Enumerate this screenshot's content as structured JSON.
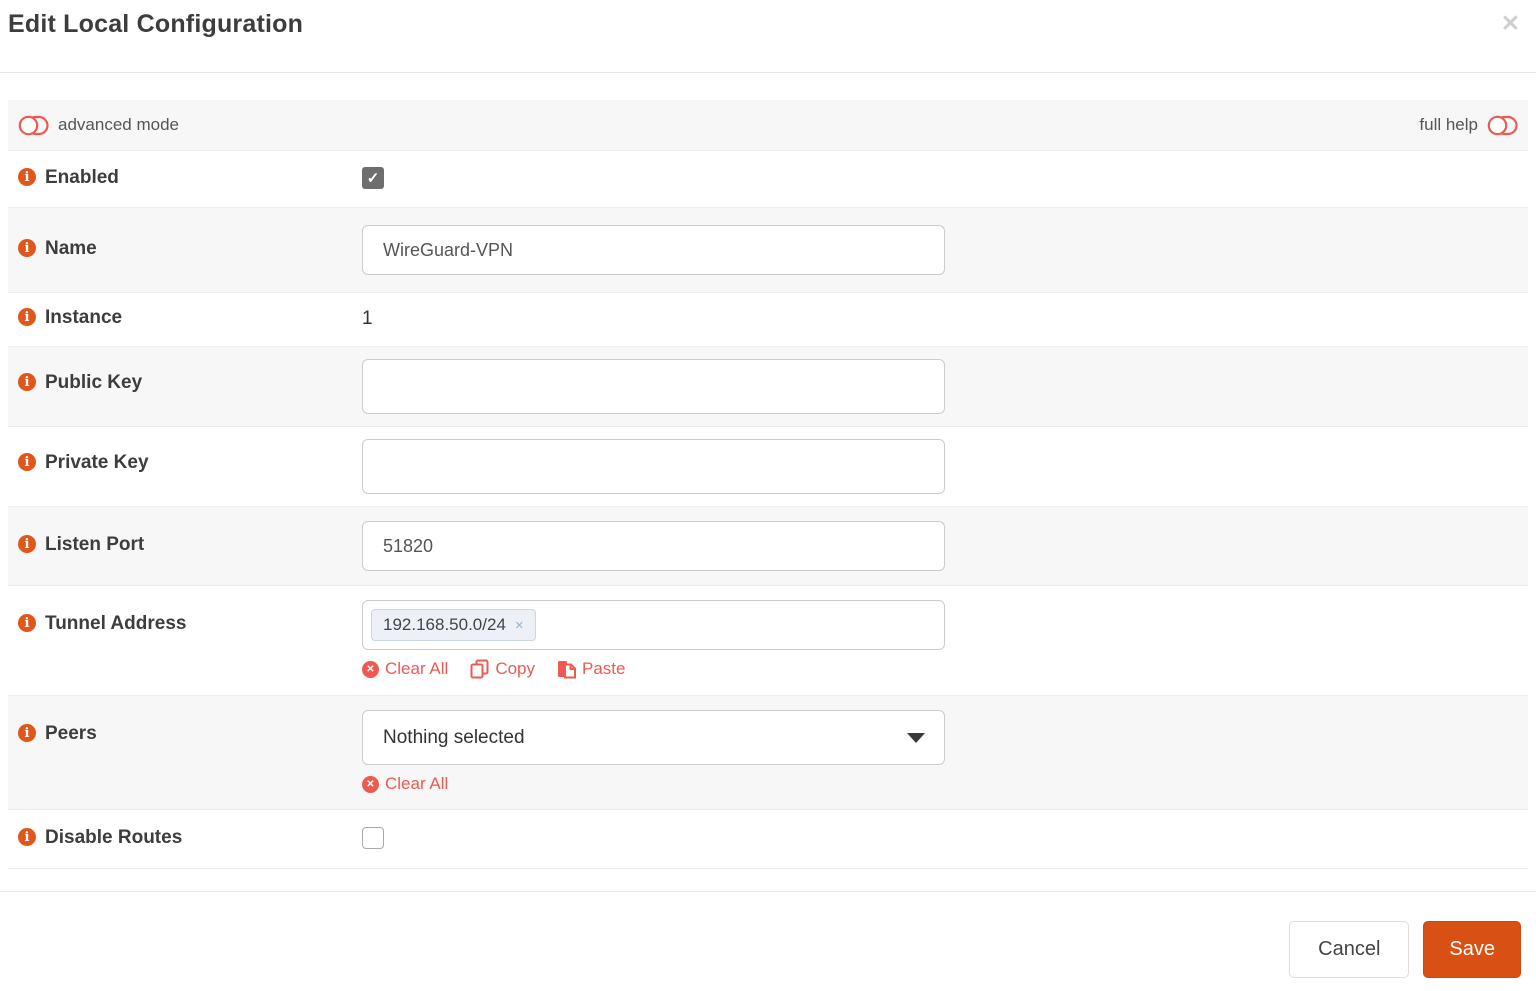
{
  "modal": {
    "title": "Edit Local Configuration"
  },
  "icons": {
    "close": "✕",
    "check": "✓",
    "tag_remove": "×",
    "clear": "✕",
    "info": "i"
  },
  "toolbar": {
    "advanced_mode_label": "advanced mode",
    "full_help_label": "full help"
  },
  "form": {
    "rows": [
      {
        "label": "Enabled",
        "control": "checkbox",
        "checked": true
      },
      {
        "label": "Name",
        "control": "text",
        "value": "WireGuard-VPN"
      },
      {
        "label": "Instance",
        "control": "static",
        "value": "1"
      },
      {
        "label": "Public Key",
        "control": "text",
        "value": ""
      },
      {
        "label": "Private Key",
        "control": "text",
        "value": ""
      },
      {
        "label": "Listen Port",
        "control": "text",
        "value": "51820"
      },
      {
        "label": "Tunnel Address",
        "control": "tags",
        "tags": [
          "192.168.50.0/24"
        ],
        "actions": {
          "clear": "Clear All",
          "copy": "Copy",
          "paste": "Paste"
        }
      },
      {
        "label": "Peers",
        "control": "select",
        "value": "Nothing selected",
        "actions": {
          "clear": "Clear All"
        }
      },
      {
        "label": "Disable Routes",
        "control": "checkbox",
        "checked": false
      }
    ]
  },
  "footer": {
    "cancel_label": "Cancel",
    "save_label": "Save"
  },
  "colors": {
    "accent_orange": "#d95014",
    "info_icon_orange": "#e0571e",
    "danger_red": "#ed5a52",
    "tag_background": "#edf1f7",
    "tag_border": "#c9d6e8",
    "row_alt_background": "#f7f7f7"
  }
}
